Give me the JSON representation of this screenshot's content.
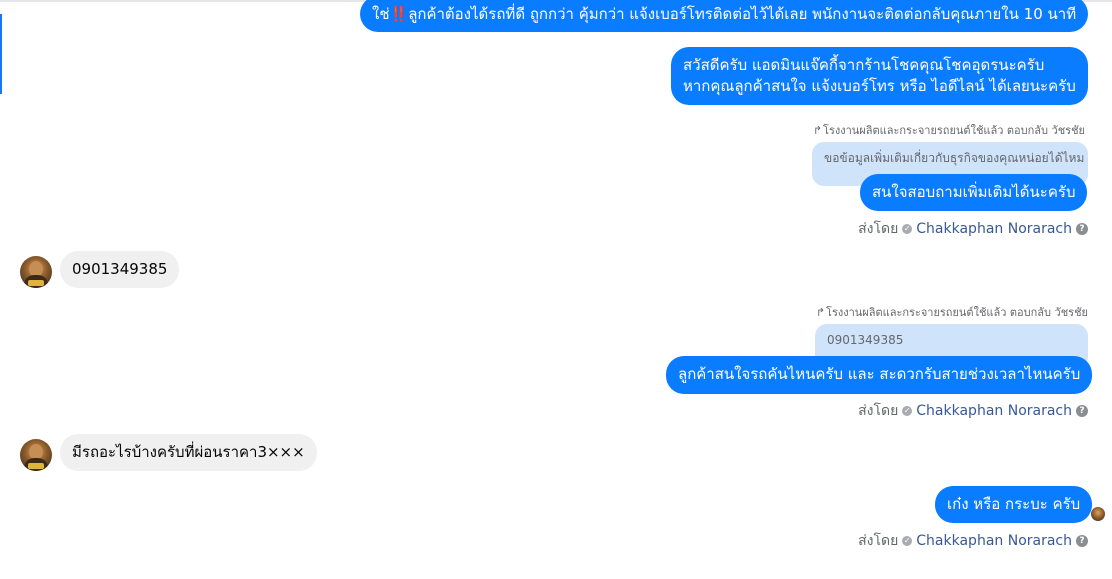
{
  "conversation": {
    "messages": [
      {
        "id": "m1",
        "text_prefix": "ใช่",
        "emoji": "‼️",
        "text_suffix": "ลูกค้าต้องได้รถที่ดี ถูกกว่า คุ้มกว่า แจ้งเบอร์โทรติดต่อไว้ได้เลย พนักงานจะติดต่อกลับคุณภายใน 10 นาที"
      },
      {
        "id": "m2",
        "line1": "สวัสดีครับ แอดมินแจ๊คกี้จากร้านโชคคุณโชคอุดรนะครับ",
        "line2": "หากคุณลูกค้าสนใจ แจ้งเบอร์โทร หรือ ไอดีไลน์ ได้เลยนะครับ"
      },
      {
        "id": "m3",
        "reply_meta": "โรงงานผลิตและกระจายรถยนต์ใช้แล้ว ตอบกลับ วัชรชัย",
        "quote": "ขอข้อมูลเพิ่มเติมเกี่ยวกับธุรกิจของคุณหน่อยได้ไหม",
        "text": "สนใจสอบถามเพิ่มเติมได้นะครับ",
        "sent_by_label": "ส่งโดย",
        "sender": "Chakkaphan Norarach"
      },
      {
        "id": "m4",
        "text": "0901349385"
      },
      {
        "id": "m5",
        "reply_meta": "โรงงานผลิตและกระจายรถยนต์ใช้แล้ว ตอบกลับ วัชรชัย",
        "quote": "0901349385",
        "text": "ลูกค้าสนใจรถคันไหนครับ และ สะดวกรับสายช่วงเวลาไหนครับ",
        "sent_by_label": "ส่งโดย",
        "sender": "Chakkaphan Norarach"
      },
      {
        "id": "m6",
        "text": "มีรถอะไรบ้างครับที่ผ่อนราคา3×××"
      },
      {
        "id": "m7",
        "text": "เก๋ง หรือ กระบะ ครับ",
        "sent_by_label": "ส่งโดย",
        "sender": "Chakkaphan Norarach"
      }
    ]
  },
  "icons": {
    "reply_arrow": "↱",
    "verified": "✓",
    "help": "?"
  },
  "colors": {
    "outgoing_bubble": "#0a7cff",
    "incoming_bubble": "#f0f0f0",
    "quote_bubble": "#cfe3fb",
    "sender_link": "#385898"
  }
}
